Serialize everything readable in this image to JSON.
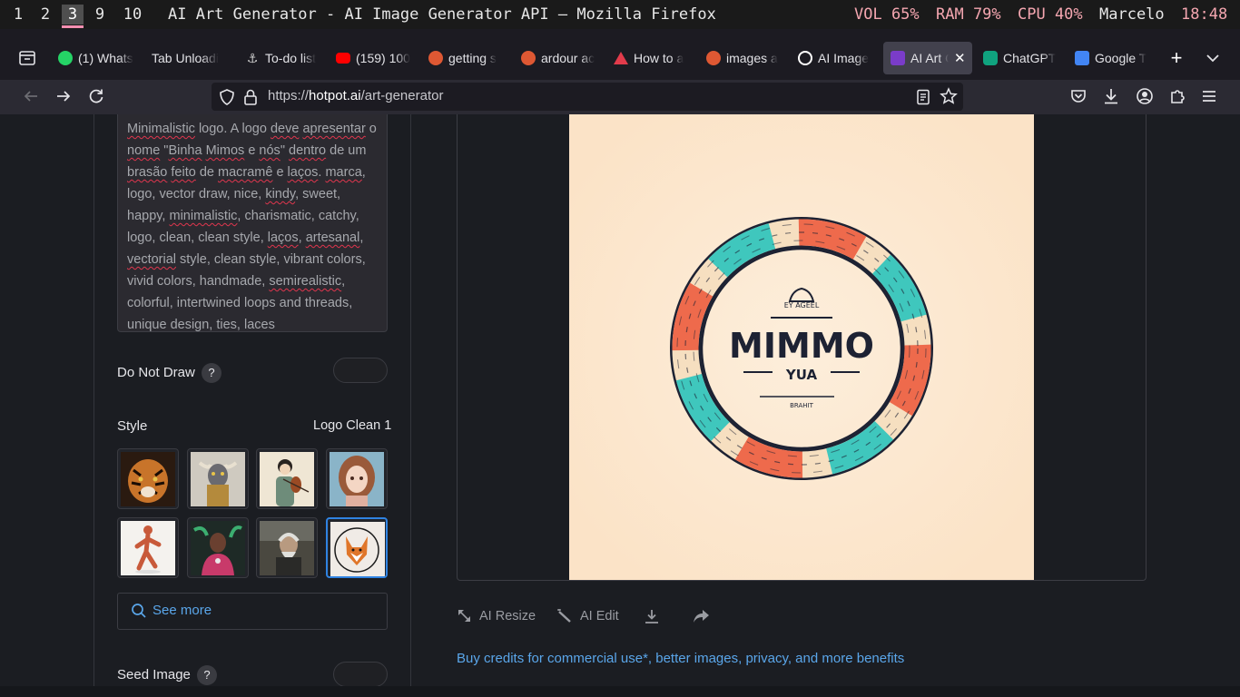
{
  "wm": {
    "workspaces": [
      "1",
      "2",
      "3",
      "9",
      "10"
    ],
    "active_workspace": "3",
    "window_title": "AI Art Generator - AI Image Generator API — Mozilla Firefox",
    "vol": "VOL 65%",
    "ram": "RAM 79%",
    "cpu": "CPU 40%",
    "user": "Marcelo",
    "clock": "18:48"
  },
  "tabs": [
    {
      "title": "(1) Whats",
      "icon": "whatsapp-icon",
      "color": "#25d366"
    },
    {
      "title": "Tab Unloadi",
      "icon": "none",
      "color": ""
    },
    {
      "title": "To-do list",
      "icon": "anchor-icon",
      "color": "#cccccc"
    },
    {
      "title": "(159) 100",
      "icon": "youtube-icon",
      "color": "#ff0000"
    },
    {
      "title": "getting s",
      "icon": "duckduckgo-icon",
      "color": "#de5833"
    },
    {
      "title": "ardour ac",
      "icon": "duckduckgo-icon",
      "color": "#de5833"
    },
    {
      "title": "How to a",
      "icon": "arch-icon",
      "color": "#e23b4b"
    },
    {
      "title": "images a",
      "icon": "duckduckgo-icon",
      "color": "#de5833"
    },
    {
      "title": "AI Image",
      "icon": "swirl-icon",
      "color": "#ffffff"
    },
    {
      "title": "AI Art G",
      "icon": "hotpot-icon",
      "color": "#7a3cc9",
      "active": true
    },
    {
      "title": "ChatGPT",
      "icon": "chatgpt-icon",
      "color": "#10a37f"
    },
    {
      "title": "Google T",
      "icon": "google-translate-icon",
      "color": "#4285f4"
    }
  ],
  "url": {
    "prefix": "https://",
    "domain": "hotpot.ai",
    "path": "/art-generator"
  },
  "prompt": {
    "segments": [
      {
        "t": "Minimalistic",
        "s": true
      },
      {
        "t": " logo. A logo "
      },
      {
        "t": "deve",
        "s": true
      },
      {
        "t": " "
      },
      {
        "t": "apresentar",
        "s": true
      },
      {
        "t": " o "
      },
      {
        "t": "nome",
        "s": true
      },
      {
        "t": " \""
      },
      {
        "t": "Binha",
        "s": true
      },
      {
        "t": " "
      },
      {
        "t": "Mimos",
        "s": true
      },
      {
        "t": " e "
      },
      {
        "t": "nós",
        "s": true
      },
      {
        "t": "\" "
      },
      {
        "t": "dentro",
        "s": true
      },
      {
        "t": " de um "
      },
      {
        "t": "brasão",
        "s": true
      },
      {
        "t": " "
      },
      {
        "t": "feito",
        "s": true
      },
      {
        "t": " de "
      },
      {
        "t": "macramê",
        "s": true
      },
      {
        "t": " e "
      },
      {
        "t": "laços",
        "s": true
      },
      {
        "t": ". "
      },
      {
        "t": "marca",
        "s": true
      },
      {
        "t": ", logo, vector draw, nice, "
      },
      {
        "t": "kindy",
        "s": true
      },
      {
        "t": ", sweet, happy, "
      },
      {
        "t": "minimalistic",
        "s": true
      },
      {
        "t": ", charismatic, catchy, logo, clean, clean style, "
      },
      {
        "t": "laços",
        "s": true
      },
      {
        "t": ", "
      },
      {
        "t": "artesanal",
        "s": true
      },
      {
        "t": ", "
      },
      {
        "t": "vectorial",
        "s": true
      },
      {
        "t": " style, clean style, vibrant colors, vivid colors, handmade, "
      },
      {
        "t": "semirealistic",
        "s": true
      },
      {
        "t": ", colorful, intertwined loops and threads, unique design, ties, laces"
      }
    ]
  },
  "do_not_draw": {
    "label": "Do Not Draw",
    "help": "?"
  },
  "style": {
    "label": "Style",
    "selected": "Logo Clean 1",
    "thumbs": [
      {
        "name": "tiger"
      },
      {
        "name": "robot-bull"
      },
      {
        "name": "violinist"
      },
      {
        "name": "anime-girl"
      },
      {
        "name": "dancer"
      },
      {
        "name": "cyber-woman"
      },
      {
        "name": "old-man"
      },
      {
        "name": "fox-logo"
      }
    ]
  },
  "see_more": "See more",
  "seed_image": {
    "label": "Seed Image",
    "help": "?"
  },
  "generated_logo": {
    "main_text": "MIMMO",
    "sub_text": "YUA",
    "top_text": "EY AGEEL",
    "bottom_text": "BRAHIT"
  },
  "actions": {
    "resize": "AI Resize",
    "edit": "AI Edit"
  },
  "buy_link": "Buy credits for commercial use*, better images, privacy, and more benefits",
  "colors": {
    "link": "#5aa6ea",
    "selected_border": "#2f83e2",
    "logo_coral": "#ee6a4c",
    "logo_teal": "#3fc7bd",
    "logo_cream": "#f6dfc0",
    "logo_navy": "#1d2233"
  }
}
